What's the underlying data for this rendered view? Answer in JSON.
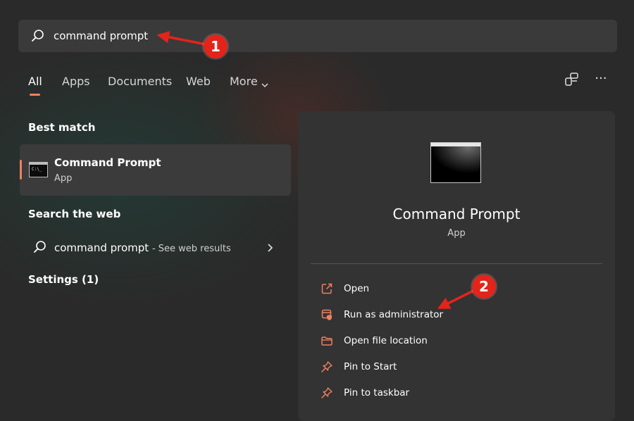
{
  "search": {
    "query": "command prompt",
    "icon": "search-icon"
  },
  "tabs": [
    {
      "label": "All",
      "active": true
    },
    {
      "label": "Apps",
      "active": false
    },
    {
      "label": "Documents",
      "active": false
    },
    {
      "label": "Web",
      "active": false
    },
    {
      "label": "More",
      "active": false
    }
  ],
  "toolbar": {
    "share_icon": "share-devices-icon",
    "more_icon": "more-options-icon",
    "more_glyph": "···"
  },
  "left_pane": {
    "best_match_title": "Best match",
    "best_match": {
      "name": "Command Prompt",
      "type": "App"
    },
    "search_web_title": "Search the web",
    "web_result": {
      "query": "command prompt",
      "suffix": "- See web results"
    },
    "settings_title": "Settings (1)"
  },
  "detail": {
    "name": "Command Prompt",
    "type": "App",
    "actions": [
      {
        "label": "Open",
        "icon": "open-external-icon"
      },
      {
        "label": "Run as administrator",
        "icon": "shield-admin-icon"
      },
      {
        "label": "Open file location",
        "icon": "folder-icon"
      },
      {
        "label": "Pin to Start",
        "icon": "pin-icon"
      },
      {
        "label": "Pin to taskbar",
        "icon": "pin-icon"
      }
    ]
  },
  "annotations": [
    {
      "number": "1"
    },
    {
      "number": "2"
    }
  ],
  "colors": {
    "accent": "#f08060",
    "callout": "#e3241b",
    "background": "#2a2a2a",
    "panel": "#333333"
  }
}
